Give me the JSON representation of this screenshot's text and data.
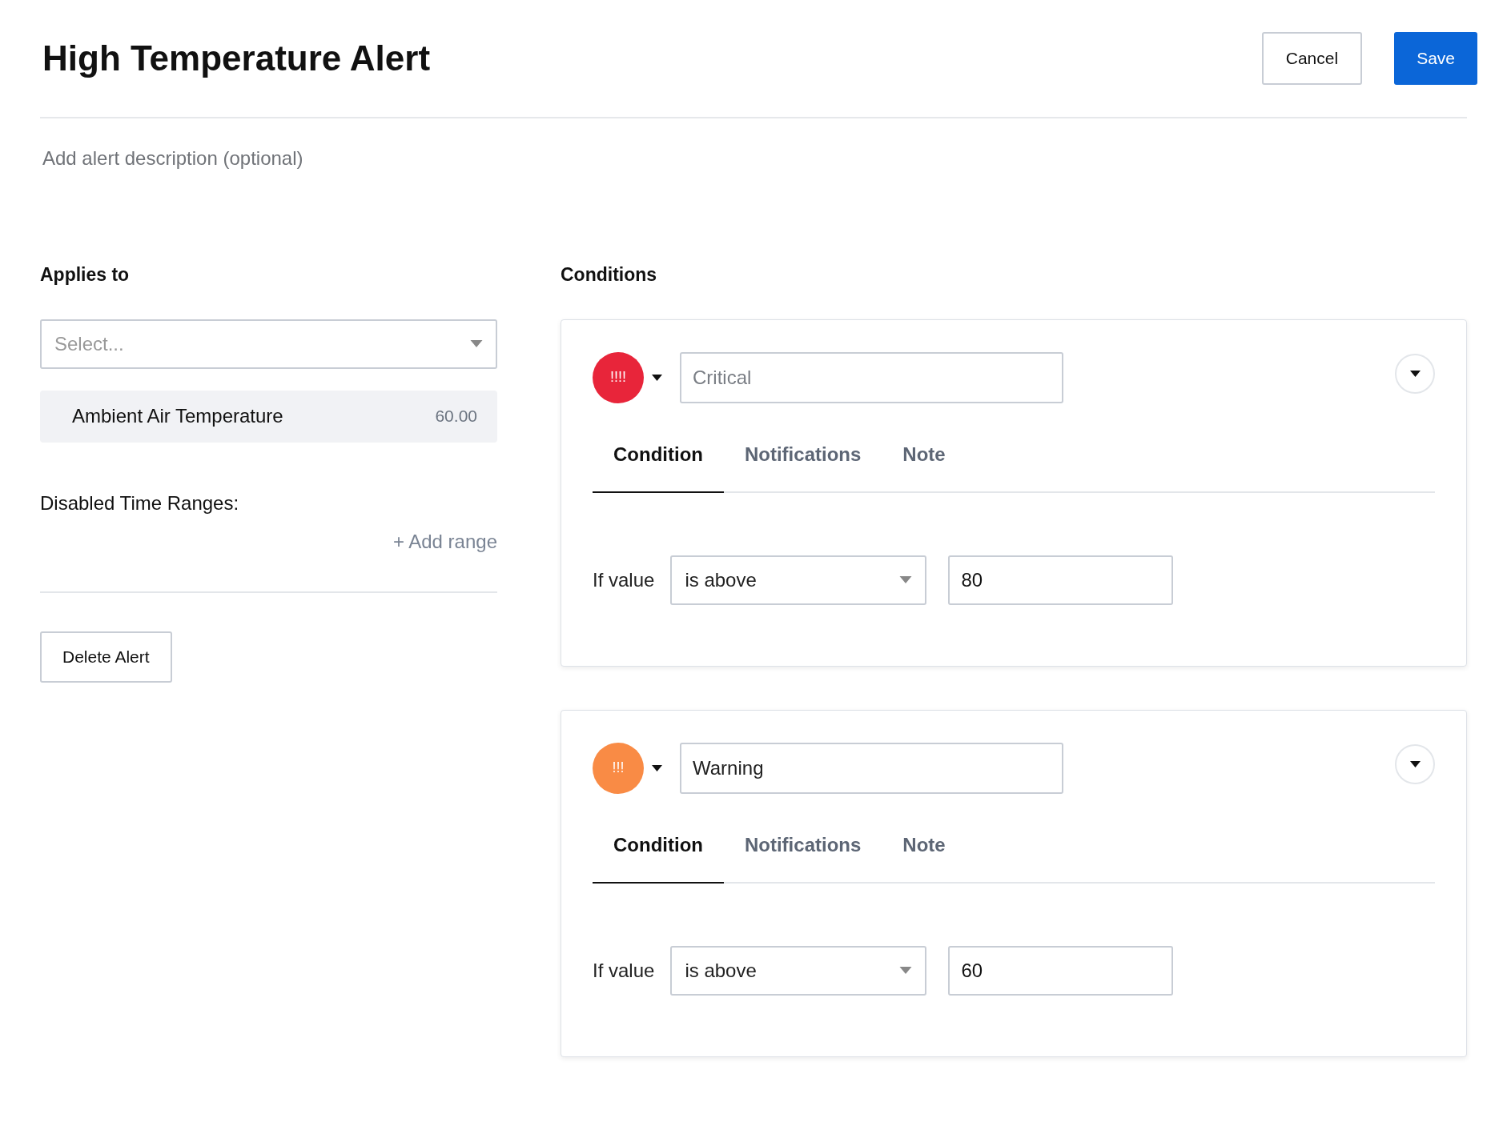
{
  "header": {
    "title": "High Temperature Alert",
    "buttons": [
      {
        "label": "Cancel",
        "kind": "secondary"
      },
      {
        "label": "Save",
        "kind": "primary"
      }
    ]
  },
  "description": {
    "placeholder": "Add alert description (optional)"
  },
  "applies_to": {
    "heading": "Applies to",
    "select": {
      "placeholder": "Select..."
    },
    "items": [
      {
        "name": "Ambient Air Temperature",
        "value": "60.00"
      }
    ],
    "disabled_ranges_label": "Disabled Time Ranges:",
    "add_range": "+ Add range",
    "delete_button": "Delete Alert"
  },
  "conditions": {
    "heading": "Conditions",
    "items": [
      {
        "badge": "!!!!",
        "color": "#e8253a",
        "name": {
          "placeholder": "Critical"
        },
        "tabs": [
          {
            "label": "Condition",
            "selected": true
          },
          {
            "label": "Notifications",
            "selected": false
          },
          {
            "label": "Note",
            "selected": false
          }
        ],
        "if_label": "If value",
        "operator": "is above",
        "threshold": "80"
      },
      {
        "badge": "!!!",
        "color": "#f98b45",
        "name": {
          "value": "Warning"
        },
        "tabs": [
          {
            "label": "Condition",
            "selected": true
          },
          {
            "label": "Notifications",
            "selected": false
          },
          {
            "label": "Note",
            "selected": false
          }
        ],
        "if_label": "If value",
        "operator": "is above",
        "threshold": "60"
      }
    ]
  }
}
